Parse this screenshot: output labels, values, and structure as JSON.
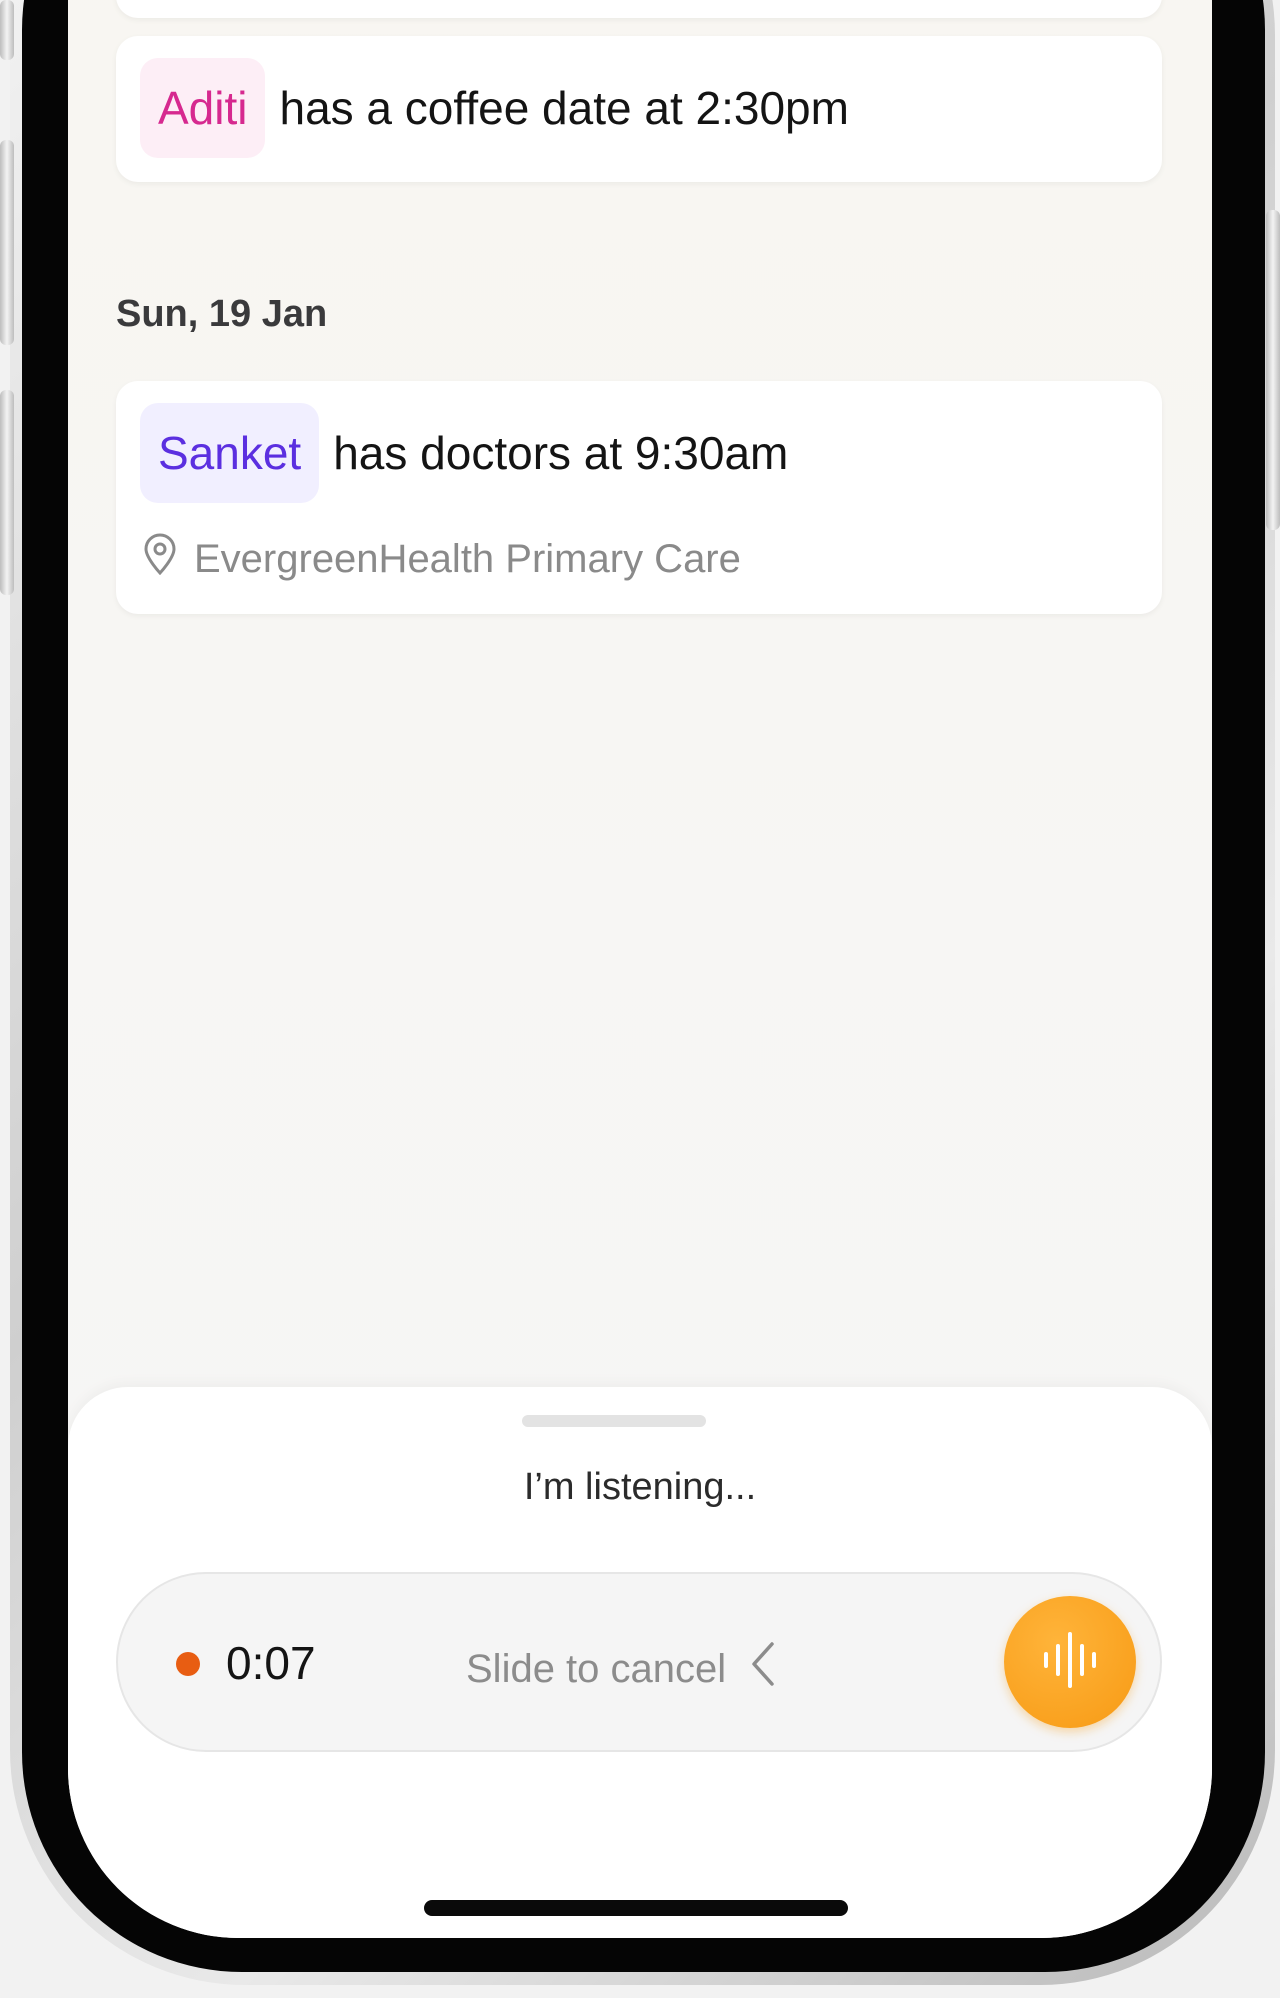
{
  "events": [
    {
      "name": "Aditi",
      "text": "has a coffee date at 2:30pm",
      "name_color": "#d6298f"
    },
    {
      "name": "Sanket",
      "text": "has doctors at 9:30am",
      "name_color": "#5b2fe0",
      "location": "EvergreenHealth Primary Care"
    }
  ],
  "date_header": "Sun, 19 Jan",
  "listening_sheet": {
    "status": "I’m listening...",
    "timer": "0:07",
    "slide_hint": "Slide to cancel",
    "record_color": "#e85d12",
    "mic_color": "#f79a14"
  },
  "icons": {
    "location": "map-pin-icon",
    "chevron": "chevron-left-icon",
    "waveform": "waveform-icon"
  }
}
